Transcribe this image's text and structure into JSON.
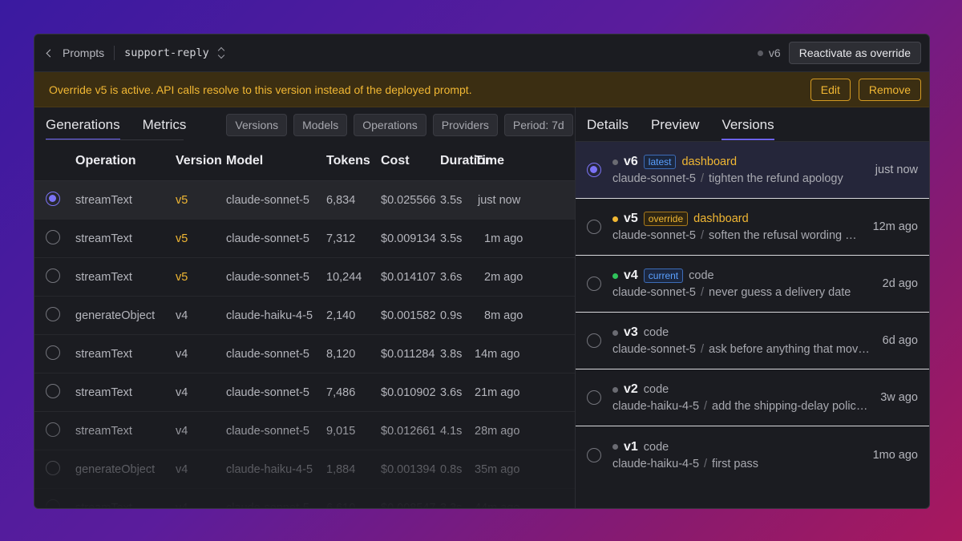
{
  "header": {
    "back_label": "Prompts",
    "prompt_name": "support-reply",
    "version_indicator": "v6",
    "reactivate_label": "Reactivate as override"
  },
  "banner": {
    "text": "Override v5 is active. API calls resolve to this version instead of the deployed prompt.",
    "edit_label": "Edit",
    "remove_label": "Remove"
  },
  "left": {
    "tabs": [
      {
        "label": "Generations"
      },
      {
        "label": "Metrics"
      }
    ],
    "filters": [
      {
        "label": "Versions"
      },
      {
        "label": "Models"
      },
      {
        "label": "Operations"
      },
      {
        "label": "Providers"
      },
      {
        "label": "Period: 7d"
      }
    ],
    "columns": {
      "operation": "Operation",
      "version": "Version",
      "model": "Model",
      "tokens": "Tokens",
      "cost": "Cost",
      "duration": "Duration",
      "time": "Time"
    },
    "rows": [
      {
        "operation": "streamText",
        "version": "v5",
        "model": "claude-sonnet-5",
        "tokens": "6,834",
        "cost": "$0.025566",
        "duration": "3.5s",
        "time": "just now",
        "selected": true
      },
      {
        "operation": "streamText",
        "version": "v5",
        "model": "claude-sonnet-5",
        "tokens": "7,312",
        "cost": "$0.009134",
        "duration": "3.5s",
        "time": "1m ago"
      },
      {
        "operation": "streamText",
        "version": "v5",
        "model": "claude-sonnet-5",
        "tokens": "10,244",
        "cost": "$0.014107",
        "duration": "3.6s",
        "time": "2m ago"
      },
      {
        "operation": "generateObject",
        "version": "v4",
        "model": "claude-haiku-4-5",
        "tokens": "2,140",
        "cost": "$0.001582",
        "duration": "0.9s",
        "time": "8m ago"
      },
      {
        "operation": "streamText",
        "version": "v4",
        "model": "claude-sonnet-5",
        "tokens": "8,120",
        "cost": "$0.011284",
        "duration": "3.8s",
        "time": "14m ago"
      },
      {
        "operation": "streamText",
        "version": "v4",
        "model": "claude-sonnet-5",
        "tokens": "7,486",
        "cost": "$0.010902",
        "duration": "3.6s",
        "time": "21m ago"
      },
      {
        "operation": "streamText",
        "version": "v4",
        "model": "claude-sonnet-5",
        "tokens": "9,015",
        "cost": "$0.012661",
        "duration": "4.1s",
        "time": "28m ago"
      },
      {
        "operation": "generateObject",
        "version": "v4",
        "model": "claude-haiku-4-5",
        "tokens": "1,884",
        "cost": "$0.001394",
        "duration": "0.8s",
        "time": "35m ago"
      },
      {
        "operation": "streamText",
        "version": "v4",
        "model": "claude-sonnet-5",
        "tokens": "6,610",
        "cost": "$0.008547",
        "duration": "3.3s",
        "time": "44m ago"
      }
    ]
  },
  "right": {
    "tabs": [
      {
        "label": "Details"
      },
      {
        "label": "Preview"
      },
      {
        "label": "Versions"
      }
    ],
    "versions": [
      {
        "name": "v6",
        "badge": "latest",
        "source": "dashboard",
        "model": "claude-sonnet-5",
        "note": "tighten the refund apology",
        "time": "just now",
        "dot": "#6a6b72",
        "selected": true
      },
      {
        "name": "v5",
        "badge": "override",
        "source": "dashboard",
        "model": "claude-sonnet-5",
        "note": "soften the refusal wording when the order is outside policy",
        "time": "12m ago",
        "dot": "#f1b733"
      },
      {
        "name": "v4",
        "badge": "current",
        "source": "code",
        "model": "claude-sonnet-5",
        "note": "never guess a delivery date",
        "time": "2d ago",
        "dot": "#2fc35b"
      },
      {
        "name": "v3",
        "badge": "",
        "source": "code",
        "model": "claude-sonnet-5",
        "note": "ask before anything that moves money",
        "time": "6d ago",
        "dot": "#6a6b72"
      },
      {
        "name": "v2",
        "badge": "",
        "source": "code",
        "model": "claude-haiku-4-5",
        "note": "add the shipping-delay policy section",
        "time": "3w ago",
        "dot": "#6a6b72"
      },
      {
        "name": "v1",
        "badge": "",
        "source": "code",
        "model": "claude-haiku-4-5",
        "note": "first pass",
        "time": "1mo ago",
        "dot": "#6a6b72"
      }
    ]
  },
  "colors": {
    "accent": "#6d63f2",
    "amber": "#f1b733",
    "green": "#2fc35b",
    "blue": "#5aa0ff"
  }
}
